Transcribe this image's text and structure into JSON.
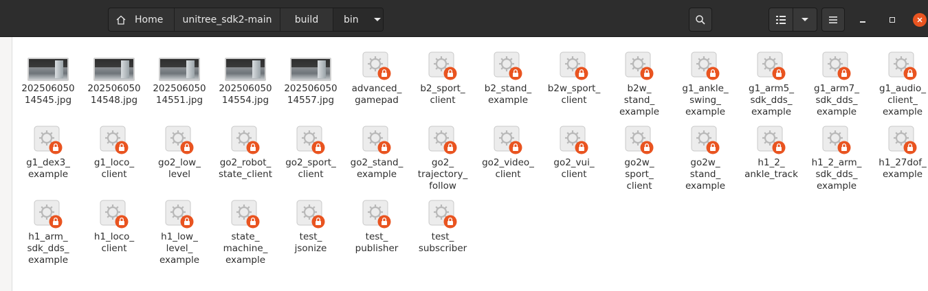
{
  "path": {
    "home": "Home",
    "segments": [
      "unitree_sdk2-main",
      "build",
      "bin"
    ]
  },
  "icons": {
    "home": "home-icon",
    "search": "search-icon",
    "list_view": "list-view-icon",
    "view_options": "chevron-down-icon",
    "menu": "hamburger-menu-icon",
    "minimize": "minimize-icon",
    "maximize": "maximize-icon",
    "close": "close-icon",
    "executable": "executable-locked-icon"
  },
  "colors": {
    "accent": "#e95420",
    "header": "#2d2d2d"
  },
  "files": [
    {
      "name": "20250605014545.jpg",
      "lines": [
        "202506050",
        "14545.jpg"
      ],
      "type": "image"
    },
    {
      "name": "20250605014548.jpg",
      "lines": [
        "202506050",
        "14548.jpg"
      ],
      "type": "image"
    },
    {
      "name": "20250605014551.jpg",
      "lines": [
        "202506050",
        "14551.jpg"
      ],
      "type": "image"
    },
    {
      "name": "20250605014554.jpg",
      "lines": [
        "202506050",
        "14554.jpg"
      ],
      "type": "image"
    },
    {
      "name": "20250605014557.jpg",
      "lines": [
        "202506050",
        "14557.jpg"
      ],
      "type": "image"
    },
    {
      "name": "advanced_gamepad",
      "lines": [
        "advanced_",
        "gamepad"
      ],
      "type": "exec"
    },
    {
      "name": "b2_sport_client",
      "lines": [
        "b2_sport_",
        "client"
      ],
      "type": "exec"
    },
    {
      "name": "b2_stand_example",
      "lines": [
        "b2_stand_",
        "example"
      ],
      "type": "exec"
    },
    {
      "name": "b2w_sport_client",
      "lines": [
        "b2w_sport_",
        "client"
      ],
      "type": "exec"
    },
    {
      "name": "b2w_stand_example",
      "lines": [
        "b2w_",
        "stand_",
        "example"
      ],
      "type": "exec"
    },
    {
      "name": "g1_ankle_swing_example",
      "lines": [
        "g1_ankle_",
        "swing_",
        "example"
      ],
      "type": "exec"
    },
    {
      "name": "g1_arm5_sdk_dds_example",
      "lines": [
        "g1_arm5_",
        "sdk_dds_",
        "example"
      ],
      "type": "exec"
    },
    {
      "name": "g1_arm7_sdk_dds_example",
      "lines": [
        "g1_arm7_",
        "sdk_dds_",
        "example"
      ],
      "type": "exec"
    },
    {
      "name": "g1_audio_client_example",
      "lines": [
        "g1_audio_",
        "client_",
        "example"
      ],
      "type": "exec"
    },
    {
      "name": "g1_dex3_example",
      "lines": [
        "g1_dex3_",
        "example"
      ],
      "type": "exec"
    },
    {
      "name": "g1_loco_client",
      "lines": [
        "g1_loco_",
        "client"
      ],
      "type": "exec"
    },
    {
      "name": "go2_low_level",
      "lines": [
        "go2_low_",
        "level"
      ],
      "type": "exec"
    },
    {
      "name": "go2_robot_state_client",
      "lines": [
        "go2_robot_",
        "state_client"
      ],
      "type": "exec"
    },
    {
      "name": "go2_sport_client",
      "lines": [
        "go2_sport_",
        "client"
      ],
      "type": "exec"
    },
    {
      "name": "go2_stand_example",
      "lines": [
        "go2_stand_",
        "example"
      ],
      "type": "exec"
    },
    {
      "name": "go2_trajectory_follow",
      "lines": [
        "go2_",
        "trajectory_",
        "follow"
      ],
      "type": "exec"
    },
    {
      "name": "go2_video_client",
      "lines": [
        "go2_video_",
        "client"
      ],
      "type": "exec"
    },
    {
      "name": "go2_vui_client",
      "lines": [
        "go2_vui_",
        "client"
      ],
      "type": "exec"
    },
    {
      "name": "go2w_sport_client",
      "lines": [
        "go2w_",
        "sport_",
        "client"
      ],
      "type": "exec"
    },
    {
      "name": "go2w_stand_example",
      "lines": [
        "go2w_",
        "stand_",
        "example"
      ],
      "type": "exec"
    },
    {
      "name": "h1_2_ankle_track",
      "lines": [
        "h1_2_",
        "ankle_track"
      ],
      "type": "exec"
    },
    {
      "name": "h1_2_arm_sdk_dds_example",
      "lines": [
        "h1_2_arm_",
        "sdk_dds_",
        "example"
      ],
      "type": "exec"
    },
    {
      "name": "h1_27dof_example",
      "lines": [
        "h1_27dof_",
        "example"
      ],
      "type": "exec"
    },
    {
      "name": "h1_arm_sdk_dds_example",
      "lines": [
        "h1_arm_",
        "sdk_dds_",
        "example"
      ],
      "type": "exec"
    },
    {
      "name": "h1_loco_client",
      "lines": [
        "h1_loco_",
        "client"
      ],
      "type": "exec"
    },
    {
      "name": "h1_low_level_example",
      "lines": [
        "h1_low_",
        "level_",
        "example"
      ],
      "type": "exec"
    },
    {
      "name": "state_machine_example",
      "lines": [
        "state_",
        "machine_",
        "example"
      ],
      "type": "exec"
    },
    {
      "name": "test_jsonize",
      "lines": [
        "test_",
        "jsonize"
      ],
      "type": "exec"
    },
    {
      "name": "test_publisher",
      "lines": [
        "test_",
        "publisher"
      ],
      "type": "exec"
    },
    {
      "name": "test_subscriber",
      "lines": [
        "test_",
        "subscriber"
      ],
      "type": "exec"
    }
  ]
}
